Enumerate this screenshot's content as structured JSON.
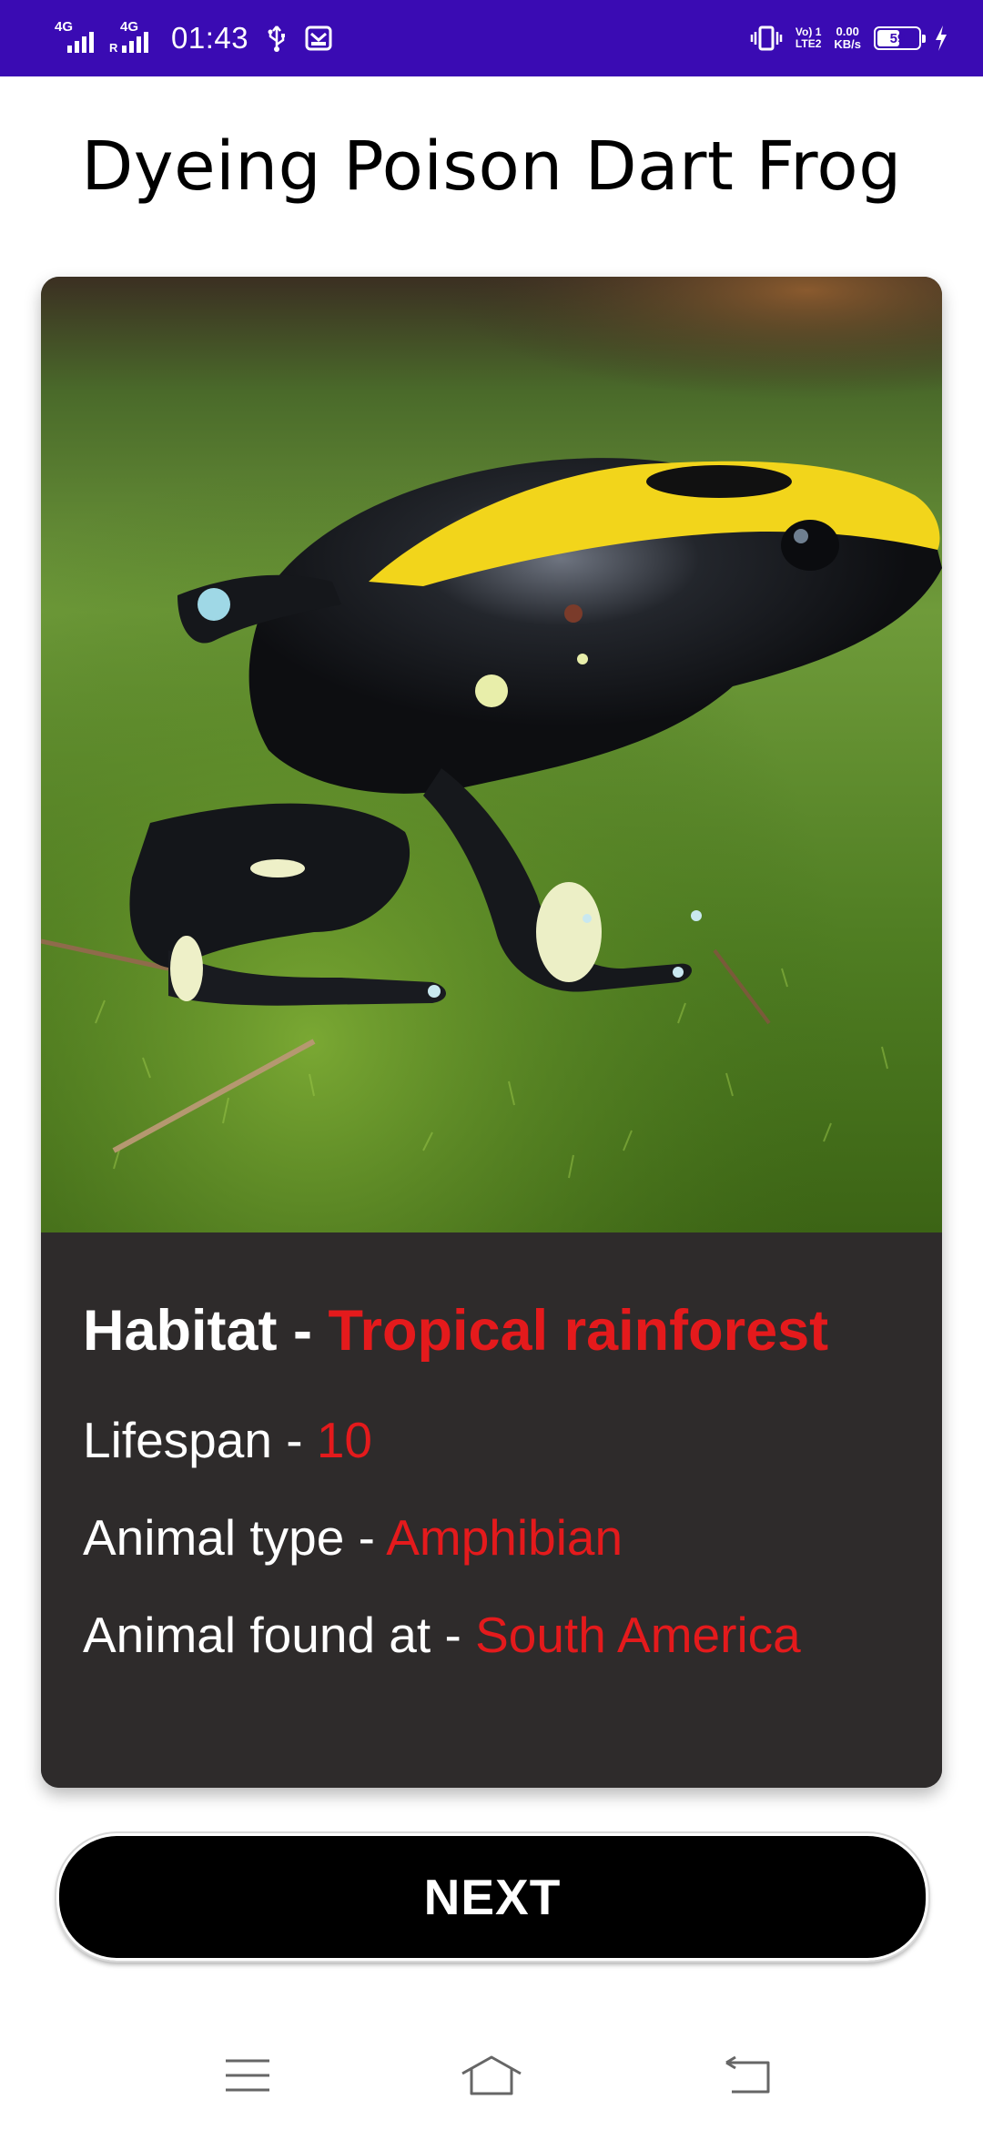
{
  "status_bar": {
    "network1": "4G",
    "network2": "4G",
    "roaming": "R",
    "time": "01:43",
    "volte": "Vo) 1",
    "volte_sub": "LTE2",
    "speed_value": "0.00",
    "speed_unit": "KB/s",
    "battery_level": "59",
    "colors": {
      "background": "#3a0bb3"
    }
  },
  "page": {
    "title": "Dyeing Poison Dart Frog"
  },
  "card": {
    "image_icon": "frog-photo",
    "habitat_label": "Habitat - ",
    "habitat_value": "Tropical rainforest",
    "lifespan_label": "Lifespan - ",
    "lifespan_value": "10",
    "type_label": "Animal type - ",
    "type_value": "Amphibian",
    "found_label": "Animal found at - ",
    "found_value": "South America",
    "colors": {
      "panel": "#2e2b2b",
      "accent": "#e41a1c"
    }
  },
  "actions": {
    "next_label": "NEXT"
  },
  "nav_bar": {
    "menu_icon": "menu-icon",
    "home_icon": "home-icon",
    "back_icon": "back-icon"
  }
}
